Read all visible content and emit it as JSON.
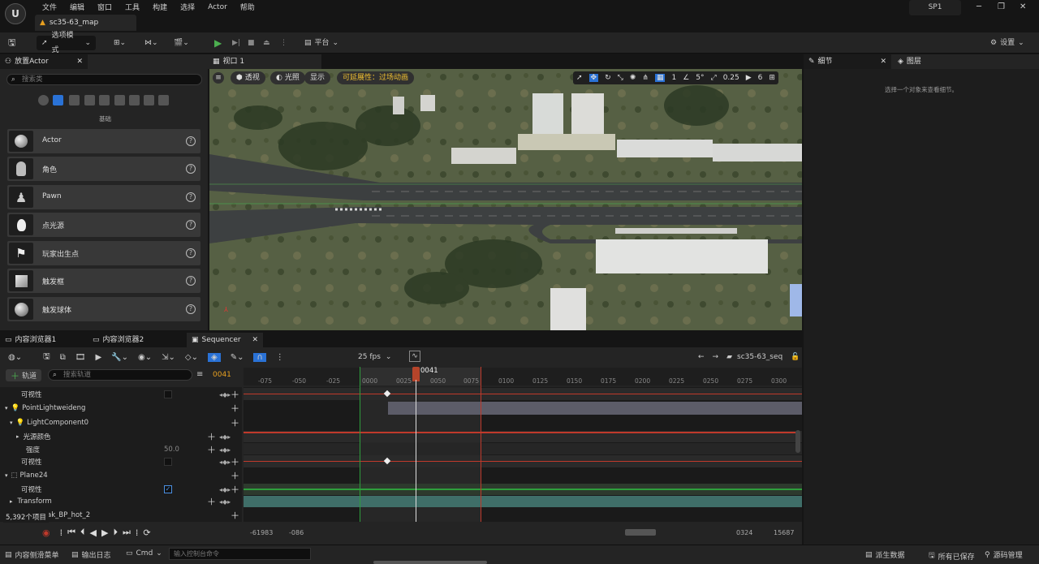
{
  "menu": [
    "文件",
    "编辑",
    "窗口",
    "工具",
    "构建",
    "选择",
    "Actor",
    "帮助"
  ],
  "doc_tab": "sc35-63_map",
  "sp1": "SP1",
  "toolbar": {
    "mode": "选项模式",
    "platform": "平台",
    "settings": "设置"
  },
  "place_actor": {
    "tab": "放置Actor",
    "search_placeholder": "搜索类",
    "category": "基础",
    "items": [
      "Actor",
      "角色",
      "Pawn",
      "点光源",
      "玩家出生点",
      "触发框",
      "触发球体"
    ]
  },
  "viewport": {
    "tab": "视口 1",
    "perspective": "透视",
    "lit": "光照",
    "show": "显示",
    "scalability": "可延展性：过场动画",
    "grid_snap": "1",
    "rot_snap": "5°",
    "scale_snap": "0.25",
    "cam_speed": "6"
  },
  "details": {
    "tab": "细节",
    "layers_tab": "图层",
    "empty": "选择一个对象来查看细节。"
  },
  "bottom_tabs": [
    "内容浏览器1",
    "内容浏览器2",
    "Sequencer"
  ],
  "sequencer": {
    "fps": "25 fps",
    "seq_name": "sc35-63_seq",
    "add_track": "轨道",
    "search_placeholder": "搜索轨道",
    "current_frame": "0041",
    "playhead": "0041",
    "ticks": [
      "-075",
      "-050",
      "-025",
      "0000",
      "0025",
      "0050",
      "0075",
      "0100",
      "0125",
      "0150",
      "0175",
      "0200",
      "0225",
      "0250",
      "0275",
      "0300"
    ],
    "tracks": [
      {
        "label": "可视性",
        "indent": 20
      },
      {
        "label": "PointLightweideng",
        "indent": 16
      },
      {
        "label": "LightComponent0",
        "indent": 22
      },
      {
        "label": "光源颜色",
        "indent": 30
      },
      {
        "label": "强度",
        "indent": 30,
        "value": "50.0"
      },
      {
        "label": "可视性",
        "indent": 24
      },
      {
        "label": "Plane24",
        "indent": 16
      },
      {
        "label": "可视性",
        "indent": 24
      },
      {
        "label": "Transform",
        "indent": 24
      },
      {
        "label": "ak_BP_hot_2",
        "indent": 56
      }
    ],
    "items_count": "5,392个项目",
    "range_start": "-61983",
    "range_view_start": "-086",
    "range_view_end": "0324",
    "range_end": "15687"
  },
  "status": {
    "drawer": "内容侧滑菜单",
    "log": "输出日志",
    "cmd": "Cmd",
    "console_placeholder": "输入控制台命令",
    "derived": "派生数据",
    "saved": "所有已保存",
    "source": "源码管理"
  }
}
